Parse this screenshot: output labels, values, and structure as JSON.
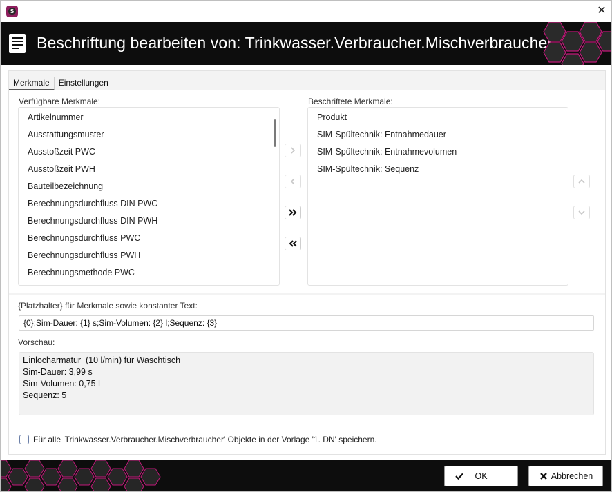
{
  "window": {
    "app_icon_letter": "S",
    "close_symbol": "✕"
  },
  "banner": {
    "title": "Beschriftung bearbeiten von: Trinkwasser.Verbraucher.Mischverbraucher"
  },
  "tabs": [
    {
      "label": "Merkmale",
      "active": true
    },
    {
      "label": "Einstellungen",
      "active": false
    }
  ],
  "available": {
    "label": "Verfügbare Merkmale:",
    "items": [
      "Artikelnummer",
      "Ausstattungsmuster",
      "Ausstoßzeit PWC",
      "Ausstoßzeit PWH",
      "Bauteilbezeichnung",
      "Berechnungsdurchfluss DIN PWC",
      "Berechnungsdurchfluss DIN PWH",
      "Berechnungsdurchfluss PWC",
      "Berechnungsdurchfluss PWH",
      "Berechnungsmethode PWC"
    ]
  },
  "labeled": {
    "label": "Beschriftete Merkmale:",
    "items": [
      "Produkt",
      "SIM-Spültechnik: Entnahmedauer",
      "SIM-Spültechnik: Entnahmevolumen",
      "SIM-Spültechnik: Sequenz"
    ]
  },
  "move_buttons": {
    "add": "chevron-right-icon",
    "remove": "chevron-left-icon",
    "add_all": "double-chevron-right-icon",
    "remove_all": "double-chevron-left-icon",
    "up": "chevron-up-icon",
    "down": "chevron-down-icon"
  },
  "placeholder": {
    "label": "{Platzhalter} für Merkmale sowie konstanter Text:",
    "value": "{0};Sim-Dauer: {1} s;Sim-Volumen: {2} l;Sequenz: {3}"
  },
  "preview": {
    "label": "Vorschau:",
    "lines": [
      "Einlocharmatur  (10 l/min) für Waschtisch",
      "Sim-Dauer: 3,99 s",
      "Sim-Volumen: 0,75 l",
      "Sequenz: 5"
    ]
  },
  "save_all": {
    "checked": false,
    "label": "Für alle 'Trinkwasser.Verbraucher.Mischverbraucher' Objekte in der Vorlage '1. DN' speichern."
  },
  "footer": {
    "ok_label": "OK",
    "cancel_label": "Abbrechen"
  },
  "colors": {
    "brand": "#8e1f5e",
    "banner_bg": "#0d0d0d",
    "hex_accent": "#c2187a"
  }
}
